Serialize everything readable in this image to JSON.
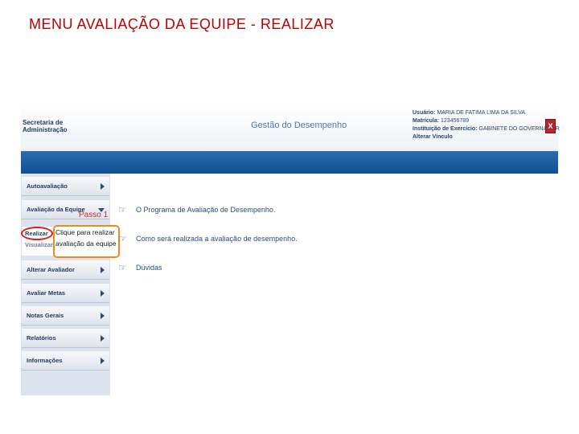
{
  "slide_title": "MENU AVALIAÇÃO DA EQUIPE - REALIZAR",
  "header": {
    "logo_line1": "Secretaria de",
    "logo_line2": "Administração",
    "app_title": "Gestão do Desempenho",
    "user_label": "Usuário:",
    "user_value": "MARIA DE FATIMA LIMA DA SILVA",
    "matricula_label": "Matrícula:",
    "matricula_value": "123456789",
    "instituicao_label": "Instituição de Exercício:",
    "instituicao_value": "GABINETE DO GOVERNADOR",
    "alterar_vinculo": "Alterar Vínculo",
    "close_label": "X"
  },
  "sidebar": {
    "items": [
      {
        "label": "Autoavaliação"
      },
      {
        "label": "Avaliação da Equipe"
      },
      {
        "label": "Alterar Avaliador"
      },
      {
        "label": "Avaliar Metas"
      },
      {
        "label": "Notas Gerais"
      },
      {
        "label": "Relatórios"
      },
      {
        "label": "Informações"
      }
    ],
    "submenu": {
      "realizar": "Realizar",
      "visualizar": "Visualizar"
    }
  },
  "annotation": {
    "step": "Passo 1",
    "callout_line1": "Clique para realizar",
    "callout_line2": "avaliação da equipe"
  },
  "content": {
    "links": [
      {
        "label": "O Programa de Avaliação de Desempenho."
      },
      {
        "label": "Como será realizada a avaliação de desempenho."
      },
      {
        "label": "Dúvidas"
      }
    ]
  },
  "colors": {
    "title_red": "#c00000",
    "nav_blue": "#0f4f91",
    "highlight_red": "#d81e1e",
    "callout_orange": "#ef8a1f"
  },
  "icons": {
    "link_icon": "pointing-hand-icon",
    "menu_arrow": "chevron-right-icon",
    "menu_arrow_open": "chevron-down-icon",
    "close": "close-icon"
  }
}
